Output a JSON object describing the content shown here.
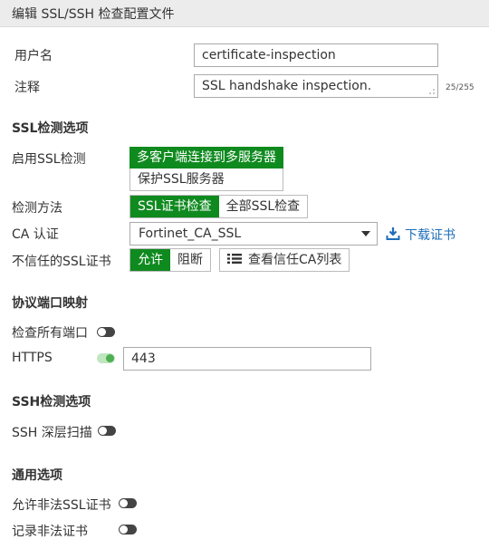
{
  "window": {
    "title": "编辑 SSL/SSH 检查配置文件"
  },
  "form": {
    "username_label": "用户名",
    "username_value": "certificate-inspection",
    "comment_label": "注释",
    "comment_value": "SSL handshake inspection.",
    "comment_counter": "25/255"
  },
  "ssl_section": {
    "title": "SSL检测选项",
    "enable_label": "启用SSL检测",
    "enable_options": [
      "多客户端连接到多服务器",
      "保护SSL服务器"
    ],
    "enable_selected": "多客户端连接到多服务器",
    "method_label": "检测方法",
    "method_options": [
      "SSL证书检查",
      "全部SSL检查"
    ],
    "method_selected": "SSL证书检查",
    "ca_label": "CA 认证",
    "ca_value": "Fortinet_CA_SSL",
    "download_label": "下载证书",
    "untrusted_label": "不信任的SSL证书",
    "untrusted_options": [
      "允许",
      "阻断"
    ],
    "untrusted_selected": "允许",
    "view_trusted_label": "查看信任CA列表"
  },
  "port_section": {
    "title": "协议端口映射",
    "inspect_all_label": "检查所有端口",
    "inspect_all_on": false,
    "https_label": "HTTPS",
    "https_on": true,
    "https_port": "443"
  },
  "ssh_section": {
    "title": "SSH检测选项",
    "deep_scan_label": "SSH 深层扫描",
    "deep_scan_on": false
  },
  "common_section": {
    "title": "通用选项",
    "allow_invalid_label": "允许非法SSL证书",
    "allow_invalid_on": false,
    "log_invalid_label": "记录非法证书",
    "log_invalid_on": false
  },
  "colors": {
    "accent": "#0f8a1f",
    "link": "#1d6fb8"
  },
  "icons": {
    "download": "download-icon",
    "list": "list-icon",
    "resize": "resize-grip-icon"
  }
}
